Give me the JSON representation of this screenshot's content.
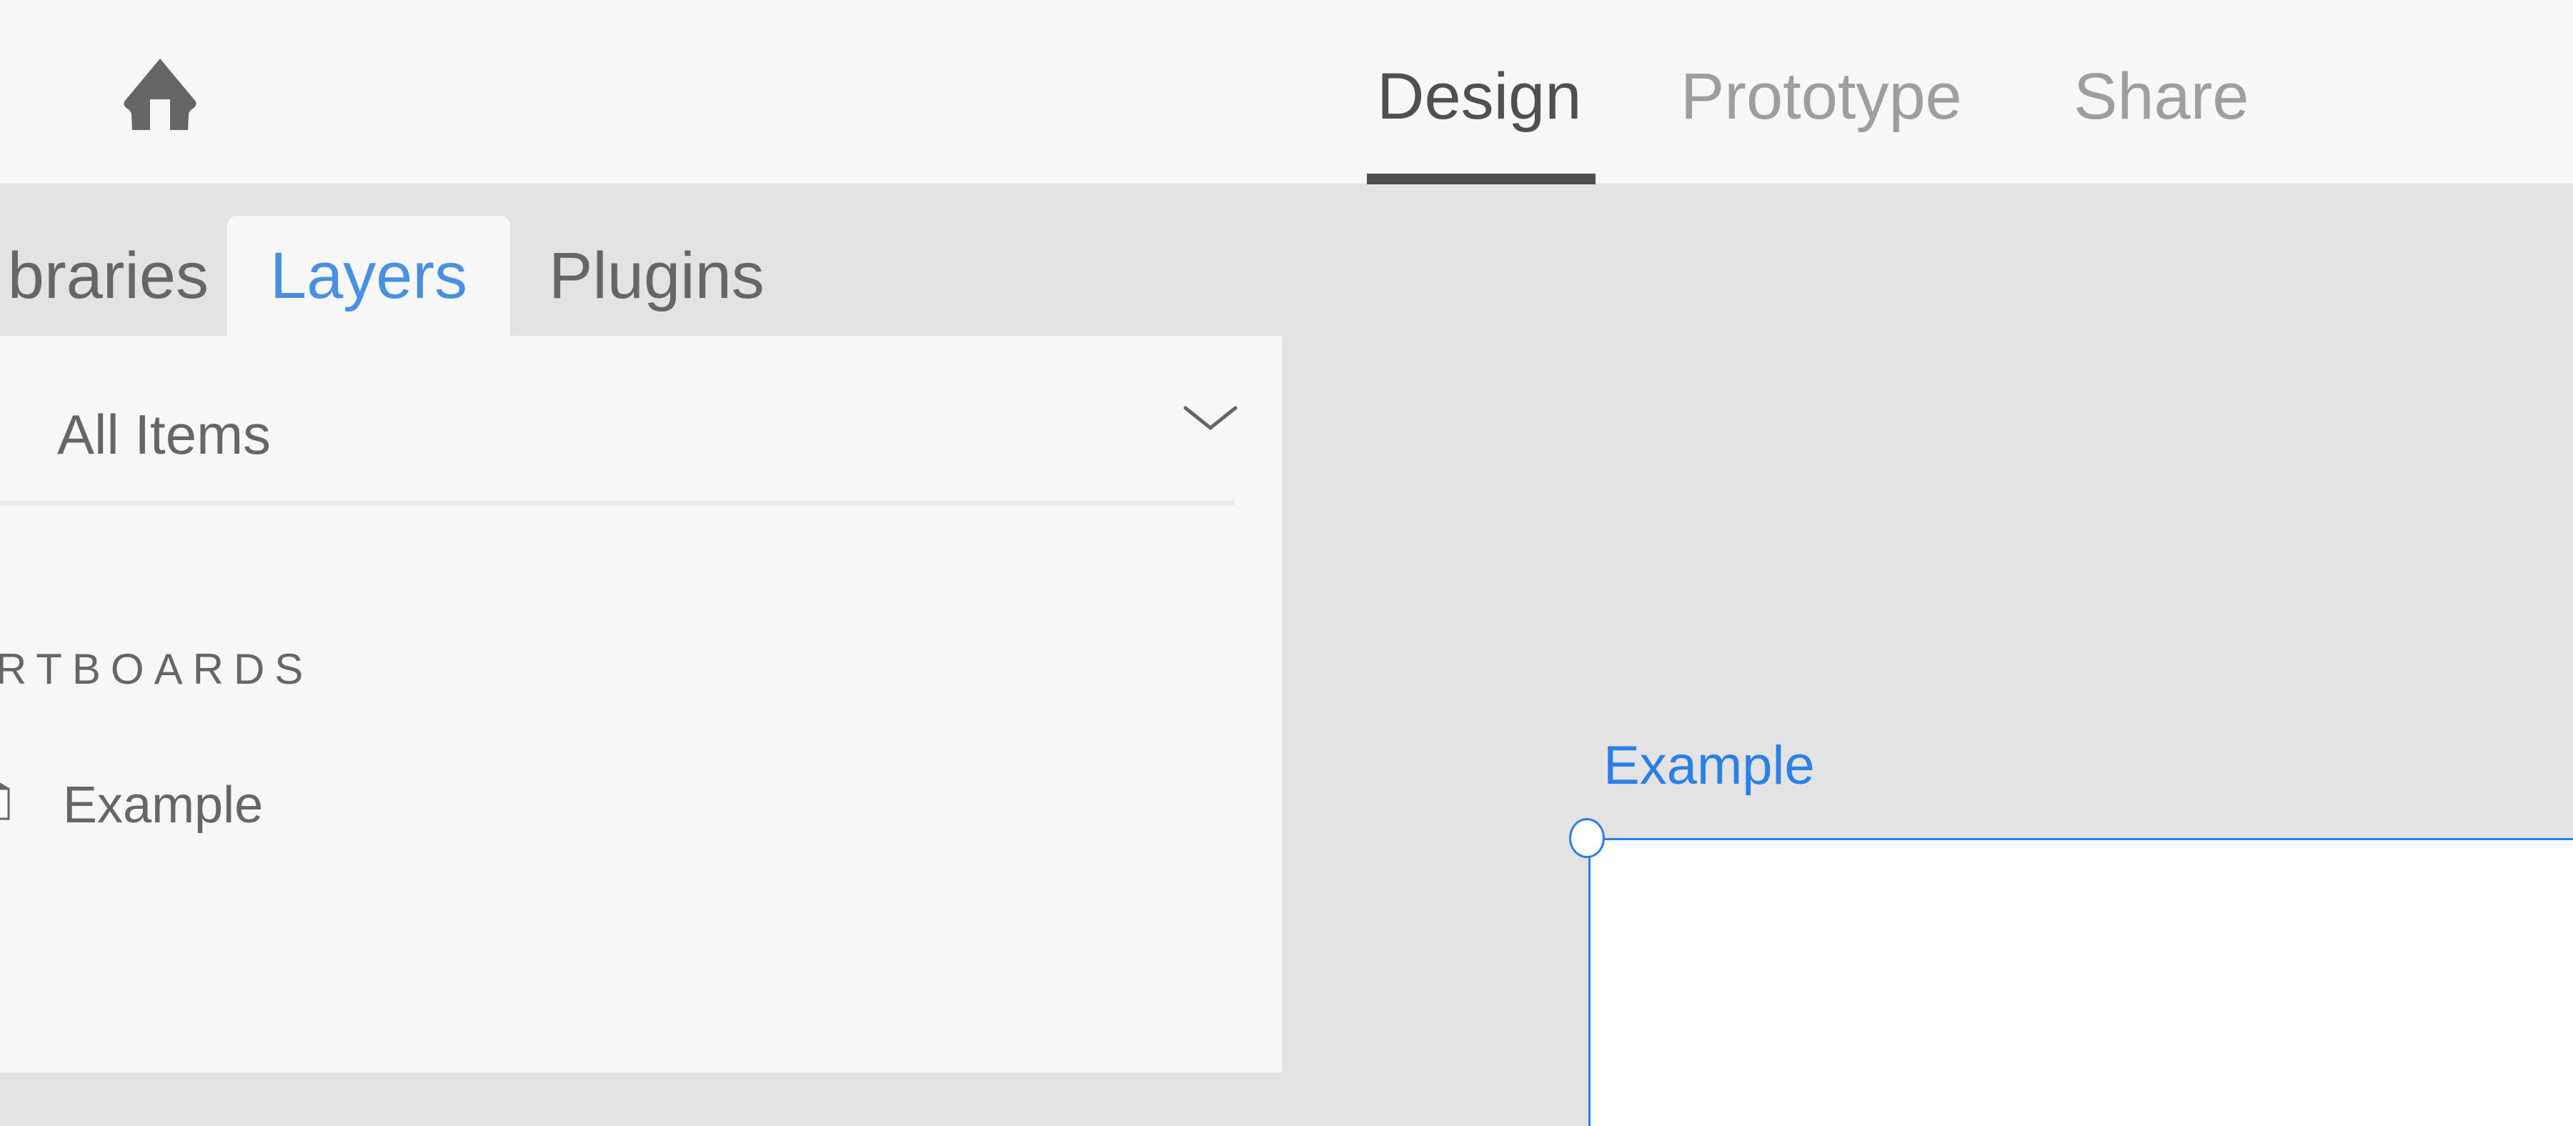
{
  "header": {
    "home_icon": "home-icon",
    "mode_tabs": [
      {
        "label": "Design",
        "active": true
      },
      {
        "label": "Prototype",
        "active": false
      },
      {
        "label": "Share",
        "active": false
      }
    ]
  },
  "panel": {
    "tabs": [
      {
        "label": "Libraries",
        "visible_text": "braries",
        "active": false
      },
      {
        "label": "Layers",
        "active": true
      },
      {
        "label": "Plugins",
        "active": false
      }
    ],
    "filter": {
      "selected": "All Items",
      "icon": "chevron-down-icon"
    },
    "section_heading": "ARTBOARDS",
    "layers": [
      {
        "label": "Example",
        "icon": "artboard-icon"
      }
    ]
  },
  "canvas": {
    "artboard_label": "Example",
    "selection_color": "#2b80e6"
  },
  "colors": {
    "header_bg": "#f7f7f7",
    "workspace_bg": "#e3e3e3",
    "active_tab_text": "#4a90e2",
    "active_mode_text": "#505050",
    "inactive_mode_text": "#9e9e9e",
    "accent": "#2b80e6"
  }
}
